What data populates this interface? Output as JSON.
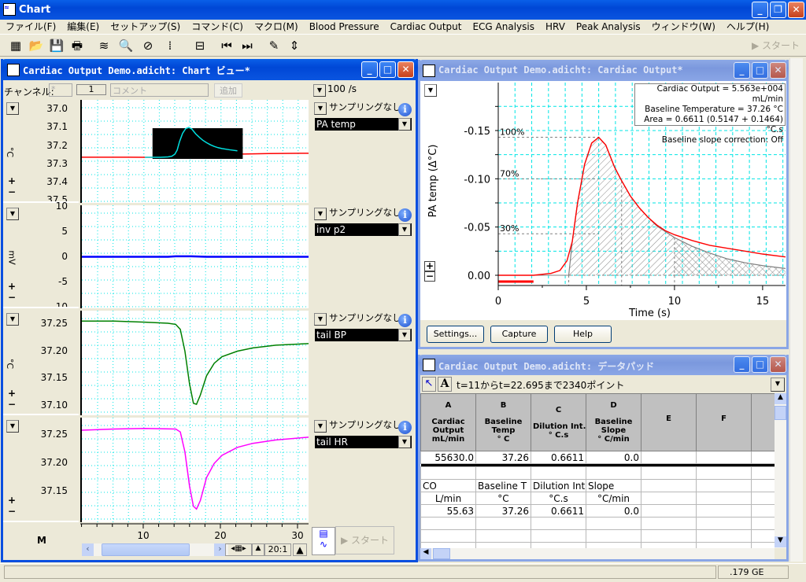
{
  "app": {
    "title": "Chart",
    "start_label": "スタート"
  },
  "menu": [
    "ファイル(F)",
    "編集(E)",
    "セットアップ(S)",
    "コマンド(C)",
    "マクロ(M)",
    "Blood Pressure",
    "Cardiac Output",
    "ECG Analysis",
    "HRV",
    "Peak Analysis",
    "ウィンドウ(W)",
    "ヘルプ(H)"
  ],
  "toolbar": [
    "new-chart-icon",
    "open-folder-icon",
    "save-icon",
    "print-icon",
    "chart-view-icon",
    "zoom-view-icon",
    "xy-view-icon",
    "data-pad-icon",
    "multiple-add-icon",
    "go-start-icon",
    "go-end-icon",
    "notebook-icon",
    "split-icon"
  ],
  "chart_view": {
    "title": "Cardiac Output Demo.adicht: Chart ビュー*",
    "channel_label": "チャンネル:",
    "channel_value": "*",
    "comment_num": "1",
    "comment_placeholder": "コメント",
    "add_label": "追加",
    "rate": "100 /s",
    "sampling": "サンプリングなし",
    "channels": [
      {
        "name": "PA temp",
        "unit": "°C",
        "ticks": [
          "37.0",
          "37.1",
          "37.2",
          "37.3",
          "37.4",
          "37.5"
        ],
        "range": [
          36.947,
          37.513
        ],
        "color": "#ff0000",
        "trace": [
          [
            1.8,
            37.262
          ],
          [
            8,
            37.262
          ],
          [
            12,
            37.263
          ],
          [
            14,
            37.262
          ],
          [
            16,
            37.255
          ],
          [
            18,
            37.25
          ],
          [
            22,
            37.245
          ],
          [
            26,
            37.242
          ],
          [
            31.4,
            37.24
          ]
        ]
      },
      {
        "name": "inv p2",
        "unit": "mV",
        "ticks": [
          "10",
          "5",
          "0",
          "-5",
          "-10"
        ],
        "range": [
          10.3,
          -10.1
        ],
        "color": "#0000ff",
        "trace": [
          [
            1.8,
            0.1
          ],
          [
            13,
            0.1
          ],
          [
            14,
            0.2
          ],
          [
            16,
            0.2
          ],
          [
            18,
            0.1
          ],
          [
            31.4,
            0.1
          ]
        ]
      },
      {
        "name": "tail BP",
        "unit": "°C",
        "ticks": [
          "37.25",
          "37.20",
          "37.15",
          "37.10"
        ],
        "range": [
          37.274,
          37.083
        ],
        "color": "#008000",
        "trace": [
          [
            1.8,
            37.255
          ],
          [
            6,
            37.255
          ],
          [
            10,
            37.253
          ],
          [
            13,
            37.251
          ],
          [
            14,
            37.249
          ],
          [
            14.6,
            37.24
          ],
          [
            15.2,
            37.2
          ],
          [
            15.8,
            37.14
          ],
          [
            16.3,
            37.105
          ],
          [
            16.7,
            37.103
          ],
          [
            17.2,
            37.12
          ],
          [
            18,
            37.155
          ],
          [
            19,
            37.178
          ],
          [
            20,
            37.19
          ],
          [
            22,
            37.2
          ],
          [
            24,
            37.206
          ],
          [
            27,
            37.211
          ],
          [
            31.4,
            37.214
          ]
        ]
      },
      {
        "name": "tail HR",
        "unit": "",
        "ticks": [
          "37.25",
          "37.20",
          "37.15"
        ],
        "range": [
          37.28,
          37.097
        ],
        "color": "#ff00ff",
        "trace": [
          [
            1.8,
            37.258
          ],
          [
            6,
            37.26
          ],
          [
            10,
            37.261
          ],
          [
            14,
            37.26
          ],
          [
            14.6,
            37.255
          ],
          [
            15.2,
            37.22
          ],
          [
            15.8,
            37.16
          ],
          [
            16.3,
            37.125
          ],
          [
            16.7,
            37.12
          ],
          [
            17.2,
            37.135
          ],
          [
            18,
            37.175
          ],
          [
            19,
            37.2
          ],
          [
            20,
            37.214
          ],
          [
            22,
            37.228
          ],
          [
            24,
            37.235
          ],
          [
            27,
            37.241
          ],
          [
            31.4,
            37.246
          ]
        ]
      }
    ],
    "time_ticks": [
      "10",
      "20",
      "30"
    ],
    "time_range": [
      1.84,
      31.43
    ],
    "selection": [
      11,
      22.695
    ],
    "compression": "20:1",
    "mark": "M"
  },
  "co_view": {
    "title": "Cardiac Output Demo.adicht: Cardiac Output*",
    "info": [
      "Cardiac Output = 5.563e+004 mL/min",
      "Baseline Temperature = 37.26 °C",
      "Area = 0.6611 (0.5147 + 0.1464) °C.s",
      "Baseline slope correction: Off"
    ],
    "buttons": {
      "settings": "Settings...",
      "capture": "Capture",
      "help": "Help"
    }
  },
  "chart_data": {
    "type": "line",
    "xlabel": "Time (s)",
    "ylabel": "PA temp (Δ°C)",
    "xlim": [
      0,
      16.3
    ],
    "ylim": [
      0.0106,
      -0.1997
    ],
    "xticks": [
      "0",
      "5",
      "10",
      "15"
    ],
    "yticks": [
      "-0.15",
      "-0.10",
      "-0.05",
      "0.00"
    ],
    "percent_labels": [
      {
        "label": "100%",
        "value": -0.143
      },
      {
        "label": "70%",
        "value": -0.1
      },
      {
        "label": "30%",
        "value": -0.043
      }
    ],
    "series": [
      {
        "color": "#ff0000",
        "x": [
          0,
          2,
          3,
          3.5,
          3.9,
          4.2,
          4.5,
          4.9,
          5.3,
          5.7,
          6.1,
          6.6,
          7,
          7.5,
          8,
          8.5,
          9,
          9.5,
          10,
          11,
          12,
          13,
          14,
          15,
          16.3
        ],
        "y": [
          0,
          0,
          -0.002,
          -0.005,
          -0.015,
          -0.035,
          -0.075,
          -0.115,
          -0.137,
          -0.143,
          -0.135,
          -0.112,
          -0.098,
          -0.082,
          -0.07,
          -0.06,
          -0.052,
          -0.046,
          -0.042,
          -0.036,
          -0.031,
          -0.028,
          -0.025,
          -0.022,
          -0.019
        ]
      },
      {
        "color": "#808080",
        "x": [
          4,
          4.2,
          4.5,
          4.9,
          5.3,
          5.7,
          6.1,
          6.6,
          7,
          7.5,
          8,
          8.5,
          9,
          10,
          11,
          12,
          13,
          14,
          15,
          16.3
        ],
        "y": [
          0,
          -0.035,
          -0.075,
          -0.115,
          -0.137,
          -0.143,
          -0.135,
          -0.112,
          -0.098,
          -0.082,
          -0.07,
          -0.06,
          -0.051,
          -0.039,
          -0.03,
          -0.023,
          -0.017,
          -0.013,
          -0.01,
          -0.007
        ]
      }
    ]
  },
  "datapad": {
    "title": "Cardiac Output Demo.adicht: データパッド",
    "range_text": "t=11からt=22.695まで2340ポイント",
    "headers": [
      [
        "A",
        "Cardiac",
        "Output",
        "mL/min"
      ],
      [
        "B",
        "Baseline",
        "Temp",
        "° C"
      ],
      [
        "C",
        "Dilution Int.",
        "° C.s",
        ""
      ],
      [
        "D",
        "Baseline",
        "Slope",
        "° C/min"
      ],
      [
        "E",
        "",
        "",
        ""
      ],
      [
        "F",
        "",
        "",
        ""
      ]
    ],
    "row1": [
      "55630.0",
      "37.26",
      "0.6611",
      "0.0"
    ],
    "labels": [
      "CO",
      "Baseline T",
      "Dilution Int",
      "Slope"
    ],
    "units": [
      "L/min",
      "°C",
      "°C.s",
      "°C/min"
    ],
    "values": [
      "55.63",
      "37.26",
      "0.6611",
      "0.0"
    ]
  },
  "status": {
    "disk": ".179 GE"
  }
}
